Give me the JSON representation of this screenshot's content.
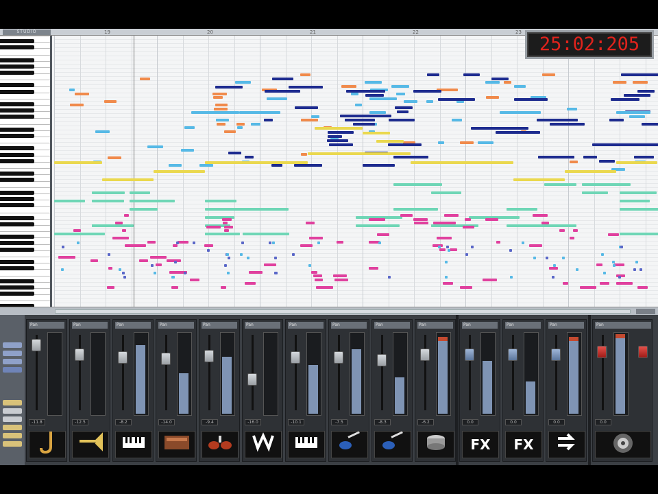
{
  "app": {
    "logo": "STUDIO"
  },
  "transport": {
    "time": "25:02:205"
  },
  "ruler": {
    "marks": [
      "19",
      "20",
      "21",
      "22",
      "23"
    ]
  },
  "mixer": {
    "strip_label": "Pan",
    "channels": [
      {
        "icon": "saxophone-icon",
        "vol": "-11.8",
        "meter": 0.0
      },
      {
        "icon": "trumpet-icon",
        "vol": "-12.5",
        "meter": 0.0
      },
      {
        "icon": "piano-icon",
        "vol": "-8.2",
        "meter": 0.85
      },
      {
        "icon": "organ-icon",
        "vol": "-14.0",
        "meter": 0.5
      },
      {
        "icon": "drum-kit-icon",
        "vol": "-9.4",
        "meter": 0.7
      },
      {
        "icon": "waves-plugin-icon",
        "vol": "-16.0",
        "meter": 0.0
      },
      {
        "icon": "piano-icon",
        "vol": "-10.1",
        "meter": 0.6
      },
      {
        "icon": "electric-guitar-icon",
        "vol": "-7.5",
        "meter": 0.8
      },
      {
        "icon": "electric-guitar-icon",
        "vol": "-8.3",
        "meter": 0.45
      },
      {
        "icon": "drum-icon",
        "vol": "-6.2",
        "meter": 0.95
      },
      {
        "icon": "fx-icon",
        "text": "FX",
        "vol": "0.0",
        "meter": 0.65
      },
      {
        "icon": "fx-icon",
        "text": "FX",
        "vol": "0.0",
        "meter": 0.4
      },
      {
        "icon": "send-arrows-icon",
        "vol": "0.0",
        "meter": 0.95
      },
      {
        "icon": "speaker-icon",
        "vol": "0.0",
        "meter": 0.98
      }
    ]
  },
  "colors": {
    "orange": "#f08a4b",
    "light_blue": "#56b9e6",
    "navy": "#1d2b8f",
    "yellow": "#ead84e",
    "mint": "#6fd6b6",
    "magenta": "#e0409e",
    "timecode": "#e0231c"
  }
}
